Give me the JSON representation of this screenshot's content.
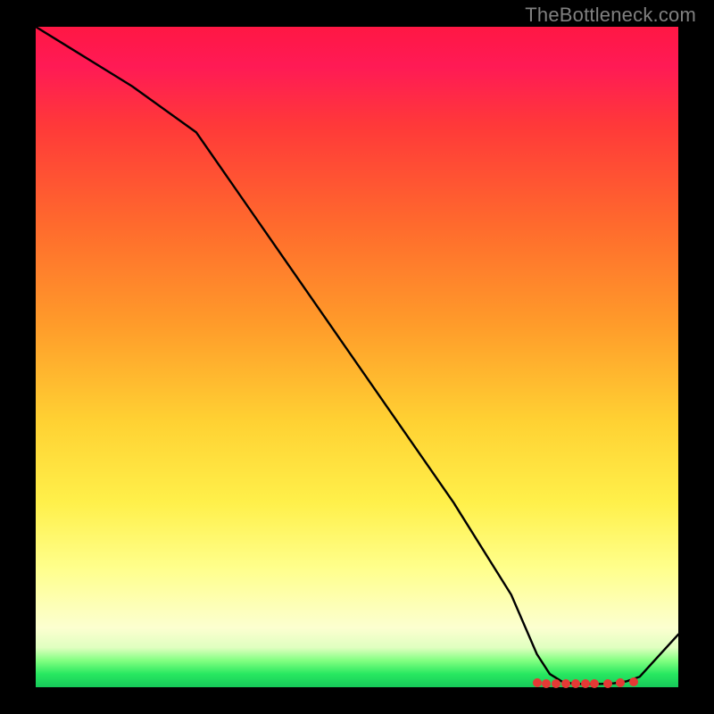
{
  "attribution": "TheBottleneck.com",
  "chart_data": {
    "type": "line",
    "title": "",
    "xlabel": "",
    "ylabel": "",
    "xlim": [
      0,
      100
    ],
    "ylim": [
      0,
      100
    ],
    "x": [
      0,
      5,
      15,
      25,
      35,
      45,
      55,
      65,
      74,
      78,
      80,
      82,
      84,
      86,
      88,
      90,
      92,
      94,
      100
    ],
    "values": [
      100,
      97,
      91,
      84,
      70,
      56,
      42,
      28,
      14,
      5,
      2,
      0.8,
      0.5,
      0.5,
      0.5,
      0.6,
      0.9,
      1.6,
      8
    ],
    "markers_x": [
      78,
      79.5,
      81,
      82.5,
      84,
      85.5,
      87,
      89,
      91,
      93
    ],
    "markers_y": [
      0.7,
      0.6,
      0.55,
      0.5,
      0.5,
      0.5,
      0.5,
      0.55,
      0.65,
      0.85
    ],
    "background_gradient": {
      "direction": "top-to-bottom",
      "stops": [
        {
          "pos": 0,
          "color": "#ff1744"
        },
        {
          "pos": 30,
          "color": "#ff6a2d"
        },
        {
          "pos": 60,
          "color": "#ffd233"
        },
        {
          "pos": 85,
          "color": "#ffffa0"
        },
        {
          "pos": 100,
          "color": "#16c95a"
        }
      ]
    }
  }
}
